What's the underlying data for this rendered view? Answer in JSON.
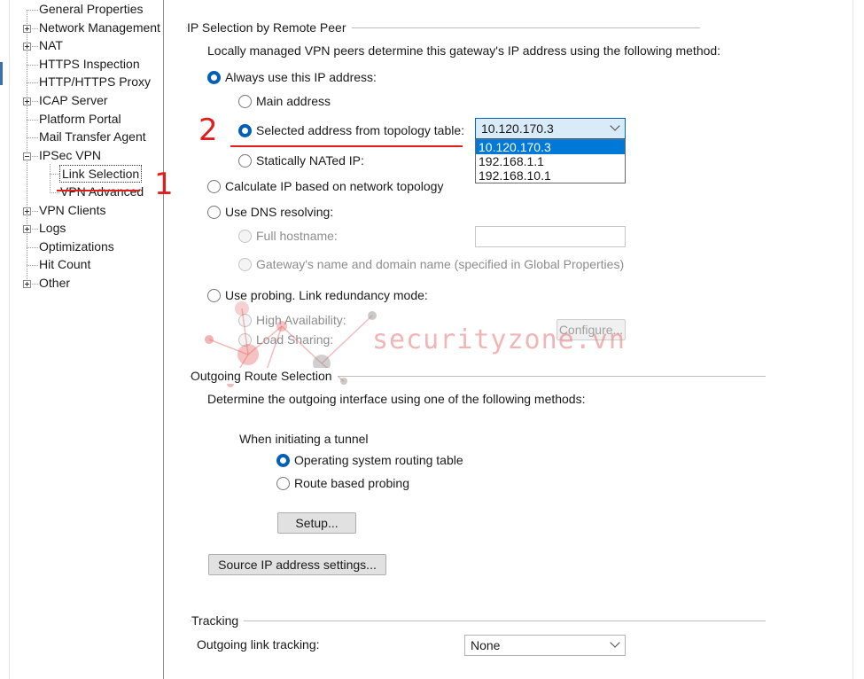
{
  "tree": {
    "items": [
      {
        "label": "General Properties",
        "expandable": false
      },
      {
        "label": "Network Management",
        "expandable": true
      },
      {
        "label": "NAT",
        "expandable": true
      },
      {
        "label": "HTTPS Inspection",
        "expandable": false
      },
      {
        "label": "HTTP/HTTPS Proxy",
        "expandable": false
      },
      {
        "label": "ICAP Server",
        "expandable": true
      },
      {
        "label": "Platform Portal",
        "expandable": false
      },
      {
        "label": "Mail Transfer Agent",
        "expandable": false
      },
      {
        "label": "IPSec VPN",
        "expandable": true,
        "expanded": true
      },
      {
        "label": "Link Selection",
        "child": true,
        "selected": true
      },
      {
        "label": "VPN Advanced",
        "child": true
      },
      {
        "label": "VPN Clients",
        "expandable": true
      },
      {
        "label": "Logs",
        "expandable": true
      },
      {
        "label": "Optimizations",
        "expandable": false
      },
      {
        "label": "Hit Count",
        "expandable": false
      },
      {
        "label": "Other",
        "expandable": true
      }
    ]
  },
  "ip_selection": {
    "title": "IP Selection by Remote Peer",
    "description": "Locally managed VPN peers determine this gateway's IP address using the following method:",
    "always_use": "Always use this IP address:",
    "main_address": "Main address",
    "selected_topology": "Selected address from topology table:",
    "statically_nated": "Statically NATed IP:",
    "topology_combo_value": "10.120.170.3",
    "topology_options": [
      "10.120.170.3",
      "192.168.1.1",
      "192.168.10.1"
    ],
    "calculate_ip": "Calculate IP based on network topology",
    "use_dns": "Use DNS resolving:",
    "full_hostname": "Full hostname:",
    "gateway_name": "Gateway's name and domain name (specified in Global Properties)",
    "use_probing": "Use probing. Link redundancy mode:",
    "high_availability": "High Availability:",
    "load_sharing": "Load Sharing:",
    "configure_button": "Configure..."
  },
  "outgoing_route": {
    "title": "Outgoing Route Selection",
    "description": "Determine the outgoing interface using one of the following methods:",
    "when_initiating": "When initiating a tunnel",
    "os_routing": "Operating system routing table",
    "route_probing": "Route based probing",
    "setup_button": "Setup...",
    "source_ip_button": "Source IP address settings..."
  },
  "tracking": {
    "title": "Tracking",
    "outgoing_link_label": "Outgoing link tracking:",
    "outgoing_link_value": "None"
  },
  "annotations": {
    "step1": "1",
    "step2": "2",
    "color": "#e01e1e"
  },
  "watermark": {
    "text": "securityzone.vn"
  },
  "colors": {
    "accent": "#005fb8",
    "selection": "#0078d7",
    "disabled_text": "#8d8d8d"
  }
}
